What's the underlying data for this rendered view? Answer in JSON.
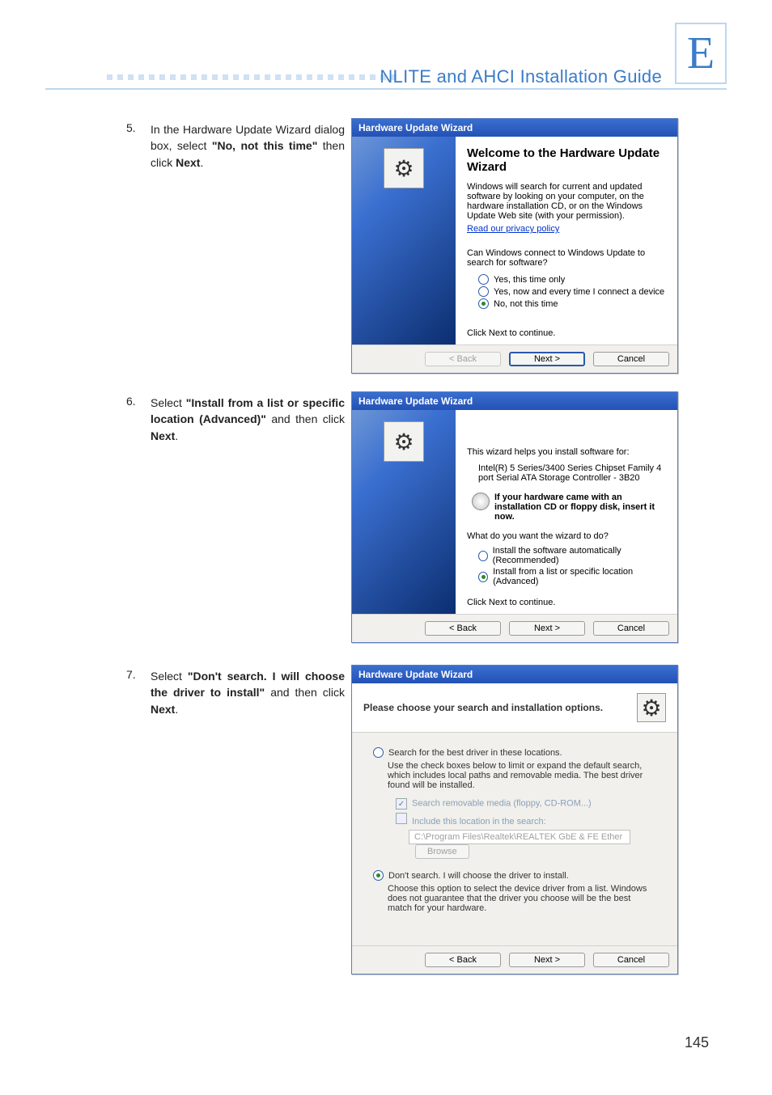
{
  "appendix_letter": "E",
  "header_title": "NLITE and AHCI Installation Guide",
  "page_number": "145",
  "steps": [
    {
      "num": "5.",
      "pre": "In the Hardware Update Wizard dialog box, select ",
      "bold1": "\"No, not this time\"",
      "mid": " then click ",
      "bold2": "Next",
      "post": "."
    },
    {
      "num": "6.",
      "pre": "Select ",
      "bold1": "\"Install from a list or specific location (Advanced)\"",
      "mid": " and then click ",
      "bold2": "Next",
      "post": "."
    },
    {
      "num": "7.",
      "pre": "Select ",
      "bold1": "\"Don't search. I will choose the driver to install\"",
      "mid": " and then click ",
      "bold2": "Next",
      "post": "."
    }
  ],
  "wizard_title": "Hardware Update Wizard",
  "wiz1": {
    "heading": "Welcome to the Hardware Update Wizard",
    "para": "Windows will search for current and updated software by looking on your computer, on the hardware installation CD, or on the Windows Update Web site (with your permission).",
    "privacy_link": "Read our privacy policy",
    "question": "Can Windows connect to Windows Update to search for software?",
    "opt1": "Yes, this time only",
    "opt2": "Yes, now and every time I connect a device",
    "opt3": "No, not this time",
    "continue": "Click Next to continue."
  },
  "wiz2": {
    "intro": "This wizard helps you install software for:",
    "device": "Intel(R) 5 Series/3400 Series Chipset Family 4 port Serial ATA Storage Controller - 3B20",
    "hint": "If your hardware came with an installation CD or floppy disk, insert it now.",
    "question": "What do you want the wizard to do?",
    "opt1": "Install the software automatically (Recommended)",
    "opt2": "Install from a list or specific location (Advanced)",
    "continue": "Click Next to continue."
  },
  "wiz3": {
    "heading": "Please choose your search and installation options.",
    "opt1": "Search for the best driver in these locations.",
    "opt1_desc": "Use the check boxes below to limit or expand the default search, which includes local paths and removable media. The best driver found will be installed.",
    "chk1": "Search removable media (floppy, CD-ROM...)",
    "chk2": "Include this location in the search:",
    "path": "C:\\Program Files\\Realtek\\REALTEK GbE & FE Ether",
    "browse": "Browse",
    "opt2": "Don't search. I will choose the driver to install.",
    "opt2_desc": "Choose this option to select the device driver from a list.  Windows does not guarantee that the driver you choose will be the best match for your hardware."
  },
  "buttons": {
    "back": "< Back",
    "next": "Next >",
    "cancel": "Cancel"
  }
}
